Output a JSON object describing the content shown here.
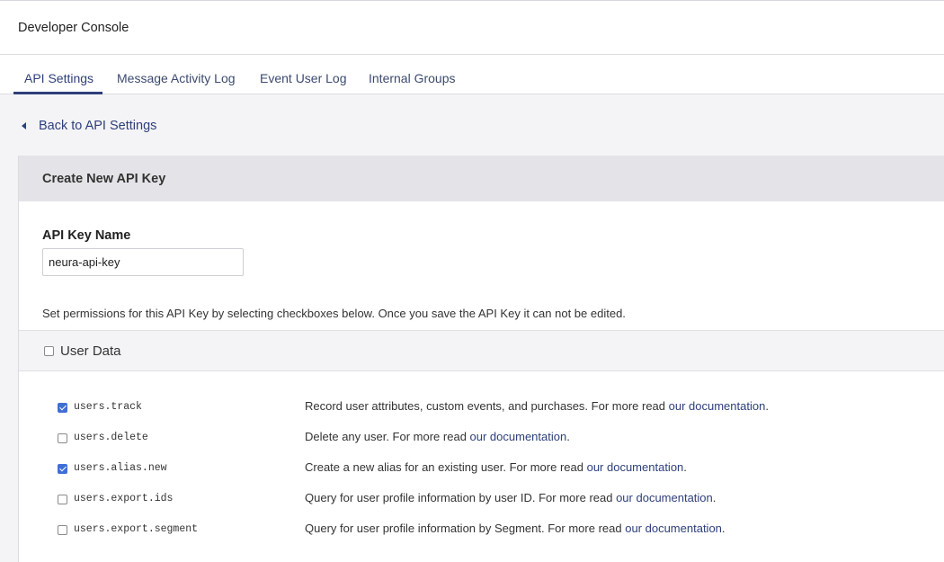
{
  "header": {
    "title": "Developer Console"
  },
  "tabs": [
    {
      "label": "API Settings",
      "active": true
    },
    {
      "label": "Message Activity Log",
      "active": false
    },
    {
      "label": "Event User Log",
      "active": false
    },
    {
      "label": "Internal Groups",
      "active": false
    }
  ],
  "back_link": {
    "label": "Back to API Settings"
  },
  "card": {
    "title": "Create New API Key",
    "name_label": "API Key Name",
    "name_value": "neura-api-key",
    "permissions_text": "Set permissions for this API Key by selecting checkboxes below. Once you save the API Key it can not be edited."
  },
  "section": {
    "label": "User Data",
    "checked": false
  },
  "permissions": [
    {
      "endpoint": "users.track",
      "checked": true,
      "description": "Record user attributes, custom events, and purchases. For more read ",
      "link": "our documentation",
      "suffix": "."
    },
    {
      "endpoint": "users.delete",
      "checked": false,
      "description": "Delete any user. For more read ",
      "link": "our documentation",
      "suffix": "."
    },
    {
      "endpoint": "users.alias.new",
      "checked": true,
      "description": "Create a new alias for an existing user. For more read ",
      "link": "our documentation",
      "suffix": "."
    },
    {
      "endpoint": "users.export.ids",
      "checked": false,
      "description": "Query for user profile information by user ID. For more read ",
      "link": "our documentation",
      "suffix": "."
    },
    {
      "endpoint": "users.export.segment",
      "checked": false,
      "description": "Query for user profile information by Segment. For more read ",
      "link": "our documentation",
      "suffix": "."
    }
  ],
  "colors": {
    "accent": "#2e3f7a",
    "checkbox_checked": "#3f6fd6"
  }
}
